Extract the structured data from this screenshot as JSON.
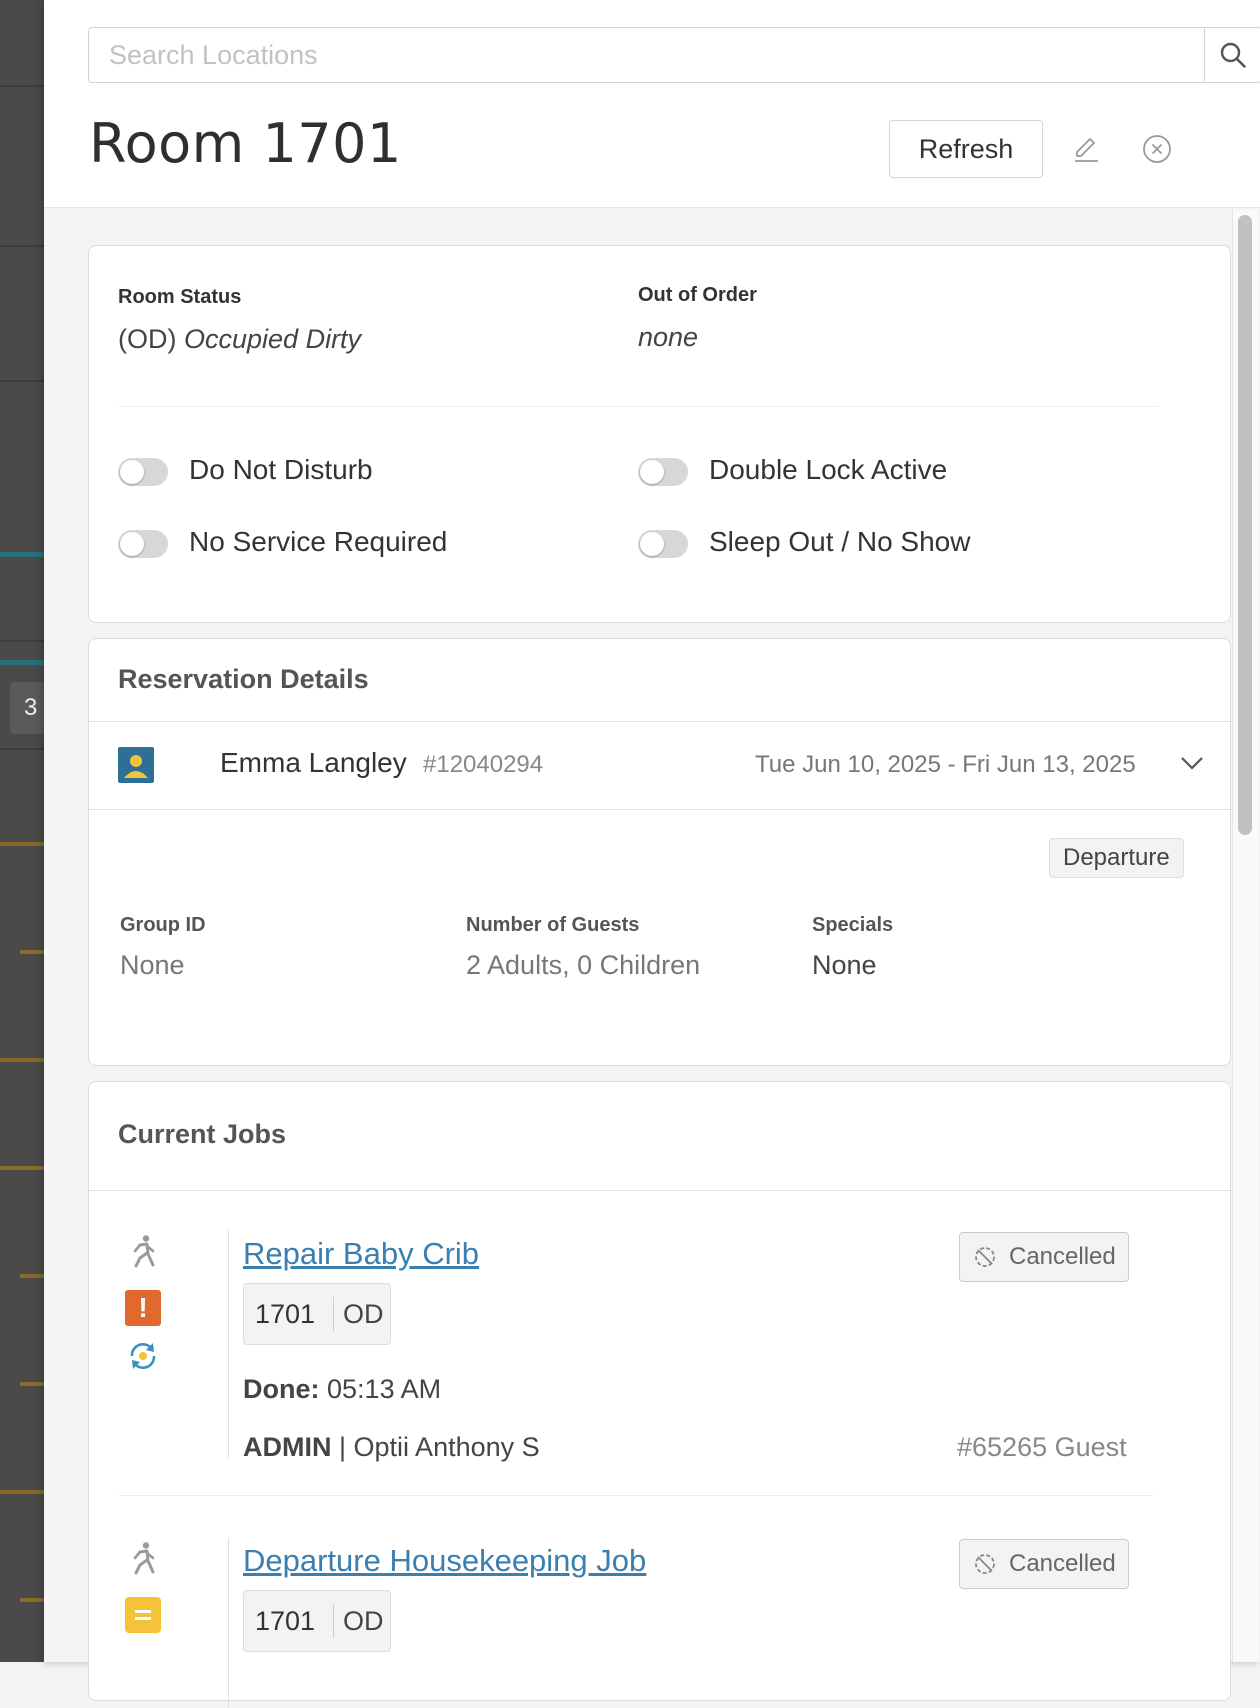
{
  "search": {
    "placeholder": "Search Locations"
  },
  "header": {
    "title": "Room 1701",
    "refresh_label": "Refresh"
  },
  "background": {
    "badge_number": "3"
  },
  "room_status": {
    "status_label": "Room Status",
    "status_code": "(OD)",
    "status_text": "Occupied Dirty",
    "ooo_label": "Out of Order",
    "ooo_value": "none",
    "toggles": [
      {
        "label": "Do Not Disturb",
        "on": false
      },
      {
        "label": "Double Lock Active",
        "on": false
      },
      {
        "label": "No Service Required",
        "on": false
      },
      {
        "label": "Sleep Out / No Show",
        "on": false
      }
    ]
  },
  "reservation": {
    "title": "Reservation Details",
    "guest_name": "Emma Langley",
    "reservation_number": "#12040294",
    "dates": "Tue Jun 10, 2025 - Fri Jun 13, 2025",
    "badge": "Departure",
    "group_id_label": "Group ID",
    "group_id_value": "None",
    "guests_label": "Number of Guests",
    "guests_value": "2 Adults, 0 Children",
    "specials_label": "Specials",
    "specials_value": "None"
  },
  "jobs": {
    "title": "Current Jobs",
    "items": [
      {
        "name": "Repair Baby Crib",
        "room": "1701",
        "room_status": "OD",
        "status": "Cancelled",
        "priority": "!",
        "done_label": "Done:",
        "done_time": "05:13 AM",
        "department": "ADMIN",
        "assignee": "| Optii Anthony S",
        "job_id": "#65265 Guest"
      },
      {
        "name": "Departure Housekeeping Job",
        "room": "1701",
        "room_status": "OD",
        "status": "Cancelled",
        "priority": "="
      }
    ]
  },
  "colors": {
    "link": "#3a7fb0",
    "priority_high": "#e06a2e",
    "priority_medium": "#f3c33a",
    "guest_icon": "#2e6f96"
  }
}
